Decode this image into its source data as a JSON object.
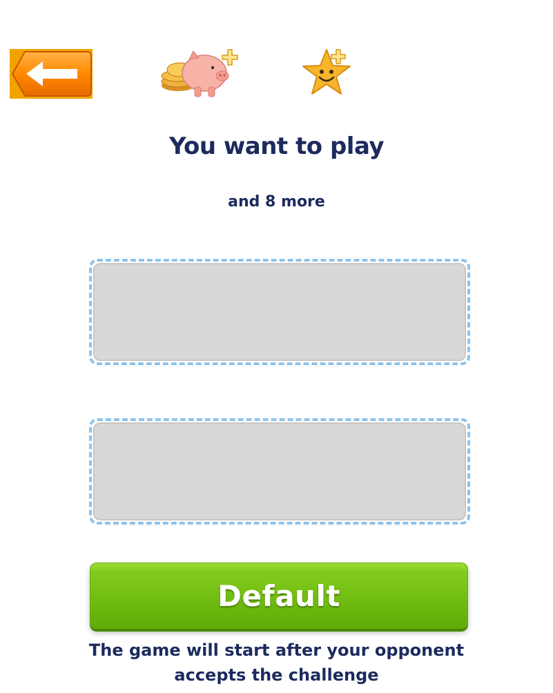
{
  "toolbar": {
    "back_icon": "arrow-left-icon",
    "coins_icon": "piggy-bank-add-icon",
    "stars_icon": "star-add-icon"
  },
  "heading": {
    "title": "You want to play",
    "subtitle": "and 8 more"
  },
  "slots": [
    {
      "label": ""
    },
    {
      "label": ""
    }
  ],
  "actions": {
    "default_label": "Default"
  },
  "info": {
    "text": "The game will start after your opponent accepts the challenge"
  },
  "colors": {
    "text": "#1c2a5e",
    "back_button": "#f3a300",
    "slot_border": "#8ec3ea",
    "slot_fill": "#d8d8d8",
    "default_button": "#72bd12"
  }
}
